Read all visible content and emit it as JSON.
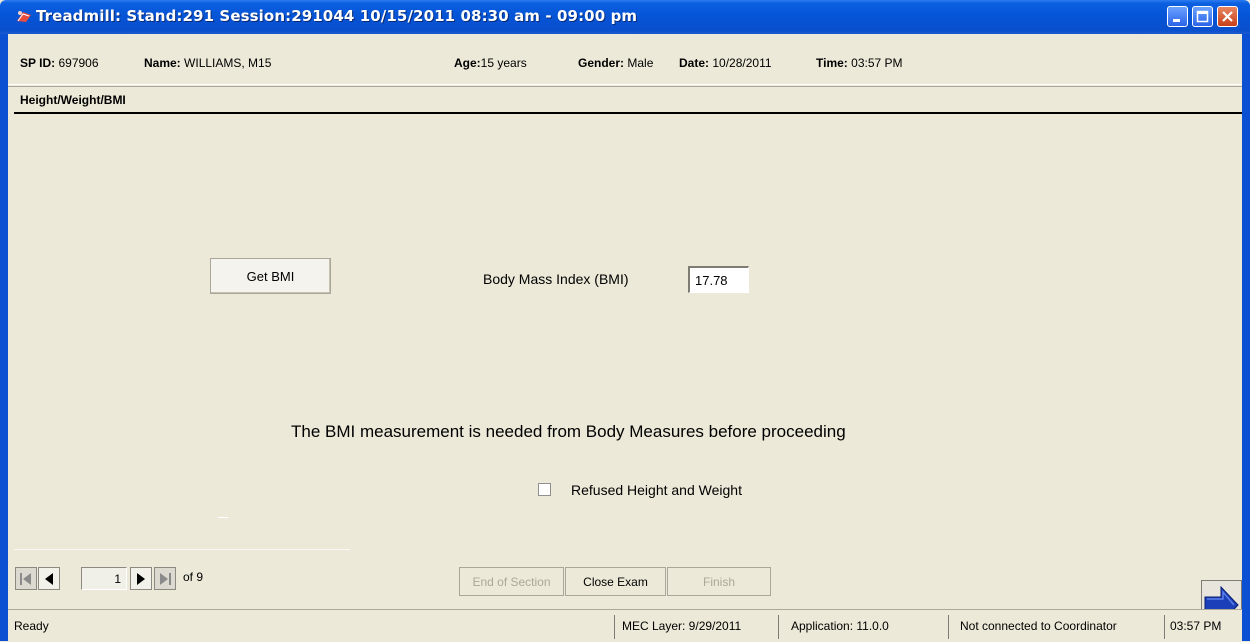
{
  "window": {
    "title": "Treadmill: Stand:291 Session:291044 10/15/2011 08:30 am - 09:00 pm"
  },
  "header": {
    "sp_id_label": "SP ID:",
    "sp_id": "697906",
    "name_label": "Name:",
    "name": "WILLIAMS, M15",
    "age_label": "Age:",
    "age": "15 years",
    "gender_label": "Gender:",
    "gender": "Male",
    "date_label": "Date:",
    "date": "10/28/2011",
    "time_label": "Time:",
    "time": "03:57 PM"
  },
  "section": {
    "title": "Height/Weight/BMI"
  },
  "main": {
    "get_bmi_label": "Get BMI",
    "bmi_label": "Body Mass Index (BMI)",
    "bmi_value": "17.78",
    "message": "The BMI measurement is needed from Body Measures before proceeding",
    "refused_label": "Refused Height and Weight",
    "refused_checked": false
  },
  "navigation": {
    "page": "1",
    "of_label": "of 9",
    "end_of_section_label": "End of Section",
    "close_exam_label": "Close Exam",
    "finish_label": "Finish"
  },
  "status_bar": {
    "status": "Ready",
    "mec_layer": "MEC Layer: 9/29/2011",
    "application": "Application: 11.0.0",
    "coordinator": "Not connected to Coordinator",
    "clock": "03:57 PM"
  },
  "colors": {
    "titlebar": "#0554d6",
    "background": "#ece9d8",
    "next_arrow": "#1a3fb8"
  }
}
